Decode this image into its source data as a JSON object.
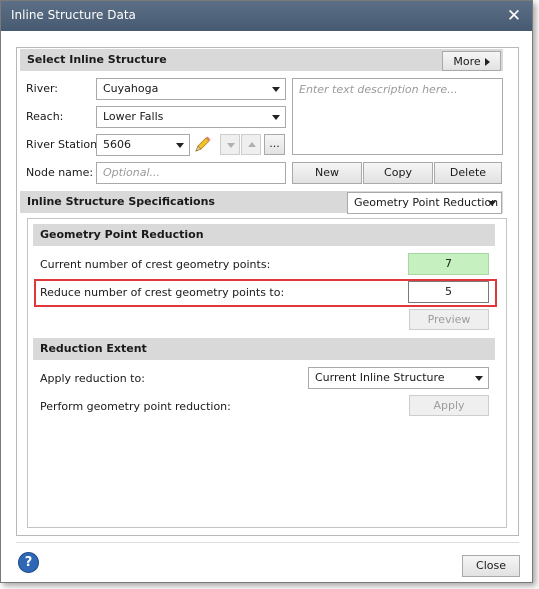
{
  "window": {
    "title": "Inline Structure Data",
    "close_glyph": "✕"
  },
  "select_section": {
    "header": "Select Inline Structure",
    "more_label": "More",
    "river_label": "River:",
    "river_value": "Cuyahoga",
    "reach_label": "Reach:",
    "reach_value": "Lower Falls",
    "station_label": "River Station:",
    "station_value": "5606",
    "ellipsis_label": "...",
    "node_label": "Node name:",
    "node_placeholder": "Optional...",
    "description_placeholder": "Enter text description here...",
    "new_label": "New",
    "copy_label": "Copy",
    "delete_label": "Delete"
  },
  "specs_section": {
    "header": "Inline Structure Specifications",
    "mode_value": "Geometry Point Reduction"
  },
  "gpr_section": {
    "header": "Geometry Point Reduction",
    "current_label": "Current number of crest geometry points:",
    "current_value": "7",
    "reduce_label": "Reduce number of crest geometry points to:",
    "reduce_value": "5",
    "preview_label": "Preview"
  },
  "extent_section": {
    "header": "Reduction Extent",
    "apply_to_label": "Apply reduction to:",
    "apply_to_value": "Current Inline Structure",
    "perform_label": "Perform geometry point reduction:",
    "apply_label": "Apply"
  },
  "footer": {
    "help_glyph": "?",
    "close_label": "Close"
  },
  "colors": {
    "titlebar": "#4f627a",
    "highlight_border": "#e0373b",
    "current_value_bg": "#c6f0c0",
    "help_button": "#2d67b5"
  },
  "icons": {
    "edit": "pencil-icon",
    "help": "help-icon"
  }
}
